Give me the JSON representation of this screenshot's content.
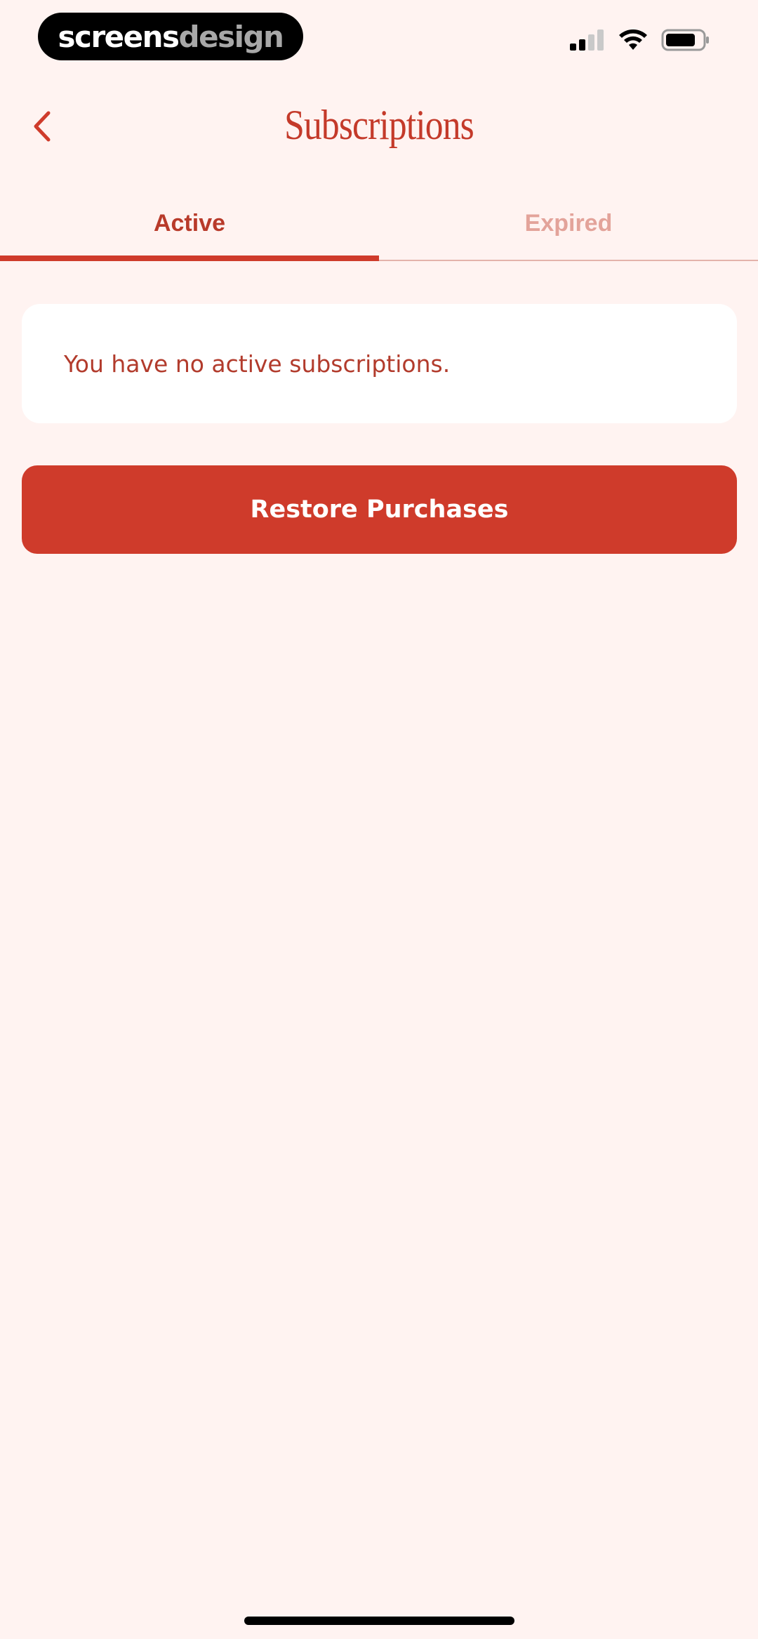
{
  "status_bar": {
    "watermark_primary": "screens",
    "watermark_secondary": "design",
    "signal_icon": "cellular-signal-icon",
    "wifi_icon": "wifi-icon",
    "battery_icon": "battery-icon"
  },
  "nav": {
    "back_icon": "chevron-left-icon",
    "title": "Subscriptions"
  },
  "tabs": [
    {
      "label": "Active",
      "selected": true
    },
    {
      "label": "Expired",
      "selected": false
    }
  ],
  "main": {
    "empty_message": "You have no active subscriptions.",
    "restore_button_label": "Restore Purchases"
  },
  "colors": {
    "background": "#fff3f1",
    "accent": "#cf3b2b",
    "accent_text": "#b83a2a",
    "inactive_tab": "#e3a39a",
    "card": "#ffffff"
  }
}
